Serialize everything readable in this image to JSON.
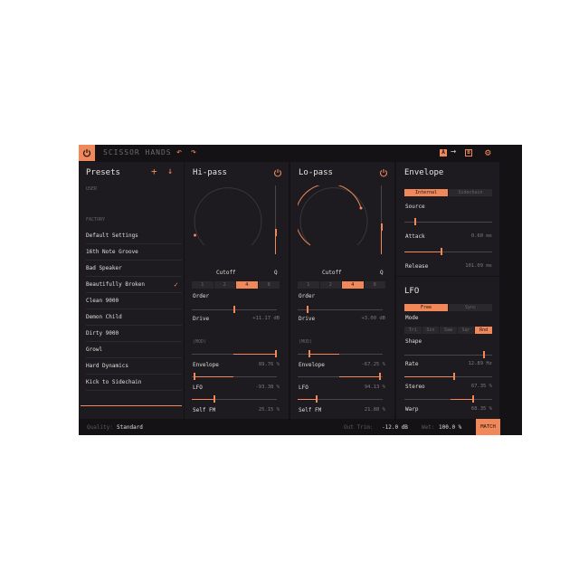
{
  "app": {
    "title": "SCISSOR HANDS",
    "accent": "#f0885a"
  },
  "toolbar": {
    "undo_icon": "undo-icon",
    "redo_icon": "redo-icon",
    "a_label": "A",
    "b_label": "B"
  },
  "presets": {
    "title": "Presets",
    "user_label": "USER",
    "factory_label": "FACTORY",
    "items": [
      "Default Settings",
      "16th Note Groove",
      "Bad Speaker",
      "Beautifully Broken",
      "Clean 9000",
      "Demon Child",
      "Dirty 9000",
      "Growl",
      "Hard Dynamics",
      "Kick to Sidechain"
    ],
    "selected": "Beautifully Broken"
  },
  "hipass": {
    "title": "Hi-pass",
    "cutoff_label": "Cutoff",
    "q_label": "Q",
    "order_label": "Order",
    "order_options": [
      "1",
      "2",
      "4",
      "8"
    ],
    "order_selected": "4",
    "drive_label": "Drive",
    "drive_value": "+11.17 dB",
    "drive_level": 0.45,
    "mod_label": "(MOD)",
    "envelope_label": "Envelope",
    "envelope_value": "89.76 %",
    "lfo_label": "LFO",
    "lfo_value": "-93.38 %",
    "selffm_label": "Self FM",
    "selffm_value": "25.15 %"
  },
  "lopass": {
    "title": "Lo-pass",
    "cutoff_label": "Cutoff",
    "q_label": "Q",
    "order_label": "Order",
    "order_options": [
      "1",
      "2",
      "4",
      "8"
    ],
    "order_selected": "4",
    "drive_label": "Drive",
    "drive_value": "+3.00 dB",
    "drive_level": 0.12,
    "mod_label": "(MOD)",
    "envelope_label": "Envelope",
    "envelope_value": "-67.25 %",
    "lfo_label": "LFO",
    "lfo_value": "94.13 %",
    "selffm_label": "Self FM",
    "selffm_value": "21.88 %"
  },
  "envelope": {
    "title": "Envelope",
    "source_options": [
      "Internal",
      "Sidechain"
    ],
    "source_selected": "Internal",
    "source_label": "Source",
    "attack_label": "Attack",
    "attack_value": "0.60 ms",
    "release_label": "Release",
    "release_value": "101.09 ms"
  },
  "lfo": {
    "title": "LFO",
    "mode_options": [
      "Free",
      "Sync"
    ],
    "mode_selected": "Free",
    "mode_label": "Mode",
    "shape_options": [
      "Tri",
      "Sin",
      "Saw",
      "Sqr",
      "Rnd"
    ],
    "shape_selected": "Rnd",
    "shape_label": "Shape",
    "rate_label": "Rate",
    "rate_value": "12.89 Hz",
    "stereo_label": "Stereo",
    "stereo_value": "67.35 %",
    "warp_label": "Warp",
    "warp_value": "68.35 %"
  },
  "footer": {
    "quality_label": "Quality:",
    "quality_value": "Standard",
    "outtrim_label": "Out Trim:",
    "outtrim_value": "-12.0 dB",
    "wet_label": "Wet:",
    "wet_value": "100.0 %",
    "match_label": "MATCH"
  }
}
